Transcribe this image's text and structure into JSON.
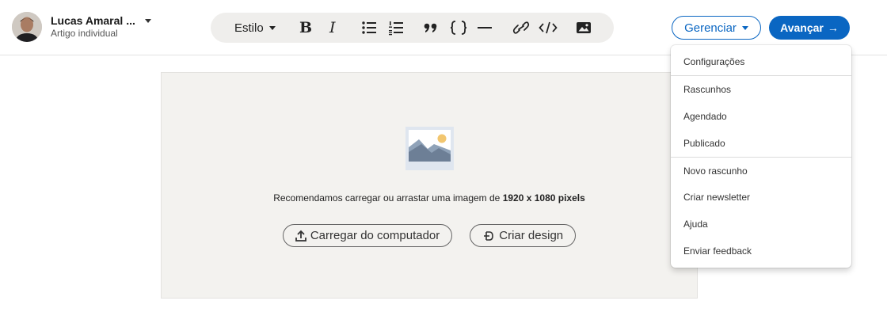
{
  "author": {
    "name": "Lucas Amaral ...",
    "subtitle": "Artigo individual"
  },
  "toolbar": {
    "style_label": "Estilo",
    "bold_label": "B",
    "italic_label": "I",
    "icons": [
      "bulleted-list-icon",
      "numbered-list-icon",
      "quote-icon",
      "code-block-icon",
      "divider-icon",
      "link-icon",
      "embed-code-icon",
      "insert-image-icon"
    ]
  },
  "header": {
    "manage_label": "Gerenciar",
    "next_label": "Avançar",
    "next_arrow": "→"
  },
  "cover": {
    "recommend_text": "Recomendamos carregar ou arrastar uma imagem de ",
    "recommend_bold": "1920 x 1080 pixels",
    "upload_label": "Carregar do computador",
    "design_label": "Criar design"
  },
  "manage_menu": {
    "items": [
      "Configurações",
      "Rascunhos",
      "Agendado",
      "Publicado",
      "Novo rascunho",
      "Criar newsletter",
      "Ajuda",
      "Enviar feedback"
    ]
  },
  "colors": {
    "accent": "#0a66c2",
    "canvas_bg": "#f3f2ef",
    "toolbar_bg": "#efeeec"
  }
}
